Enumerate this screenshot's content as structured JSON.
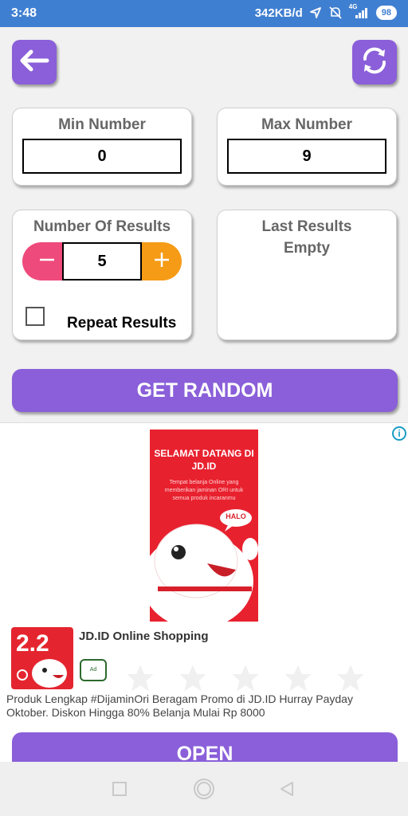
{
  "status_bar": {
    "time": "3:48",
    "speed": "342KB/d",
    "network": "4G",
    "battery": "98"
  },
  "min_card": {
    "title": "Min Number",
    "value": "0"
  },
  "max_card": {
    "title": "Max Number",
    "value": "9"
  },
  "results_card": {
    "title": "Number Of Results",
    "value": "5",
    "repeat_label": "Repeat Results",
    "repeat_checked": false
  },
  "last_results_card": {
    "title": "Last Results",
    "value": "Empty"
  },
  "get_random_label": "GET RANDOM",
  "ad": {
    "banner_title": "SELAMAT DATANG DI JD.ID",
    "banner_sub": "Tempat belanja Online yang memberikan jaminan ORI untuk semua produk incaranmu",
    "banner_mascot_text": "HALO",
    "logo_text": "2.2",
    "name": "JD.ID Online Shopping",
    "badge": "Ad",
    "rating_stars": 0,
    "description": "Produk Lengkap #DijaminOri Beragam Promo di JD.ID Hurray Payday Oktober. Diskon Hingga 80% Belanja Mulai Rp 8000",
    "cta": "OPEN",
    "info_icon": "i"
  },
  "icons": {
    "back": "arrow-left-icon",
    "refresh": "refresh-icon",
    "minus": "minus-icon",
    "plus": "plus-icon",
    "info": "info-icon",
    "nav_recents": "square-icon",
    "nav_home": "circle-icon",
    "nav_back": "triangle-back-icon"
  },
  "colors": {
    "status_bar": "#3f7fd1",
    "primary": "#8a5fd9",
    "minus": "#ef4a7c",
    "plus": "#f59b16",
    "ad_red": "#e8212f"
  }
}
